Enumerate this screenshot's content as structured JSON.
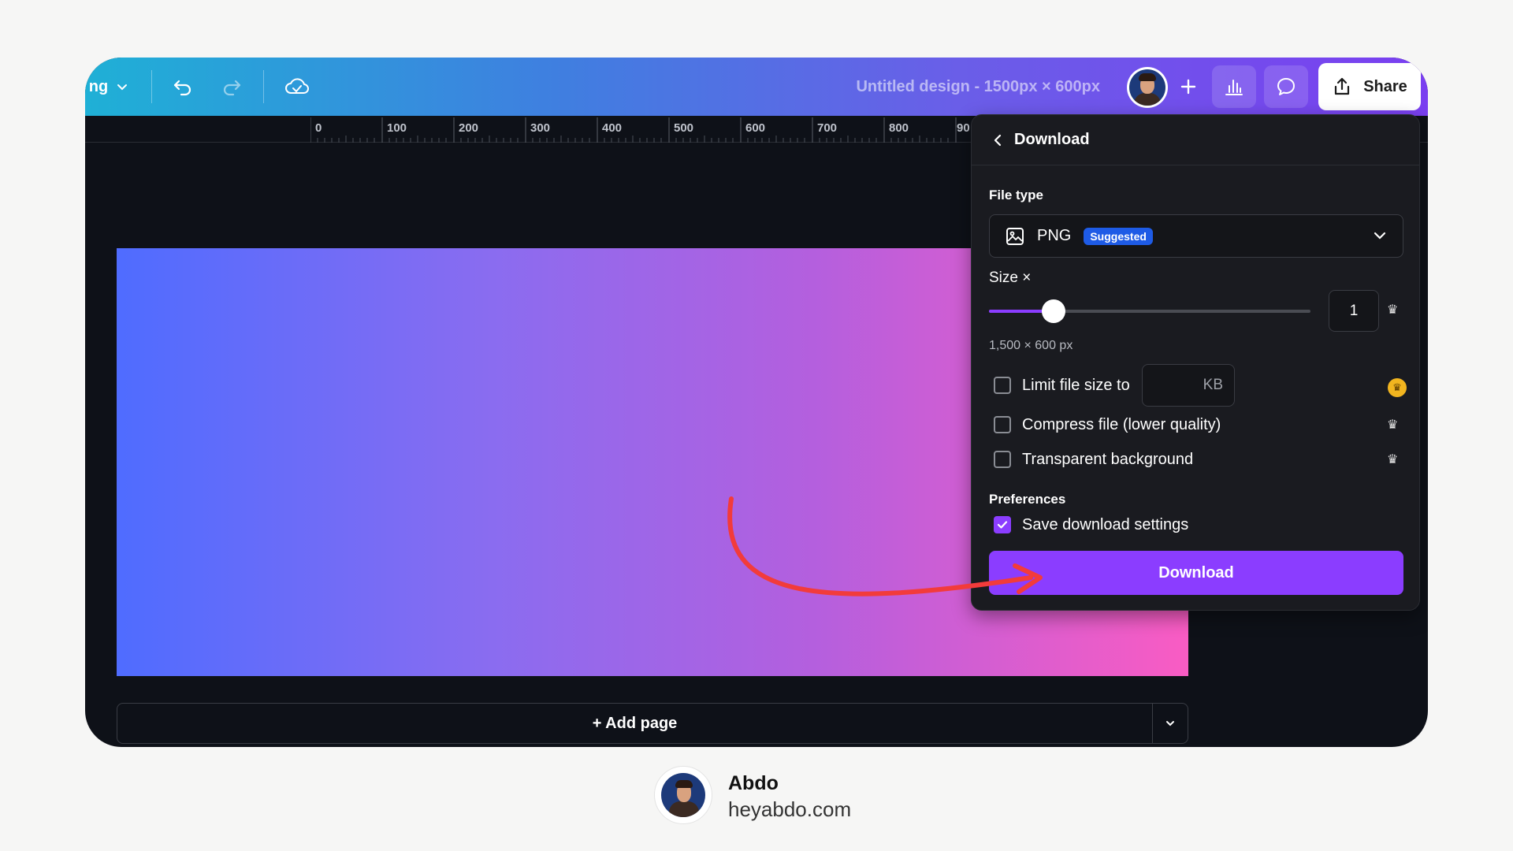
{
  "topbar": {
    "zoom_label": "ng",
    "doc_title": "Untitled design - 1500px × 600px",
    "share_label": "Share",
    "icons": [
      "chevron-down-icon",
      "undo-icon",
      "redo-icon",
      "cloud-check-icon",
      "plus-icon",
      "bar-chart-icon",
      "comment-icon",
      "share-upload-icon"
    ]
  },
  "ruler": {
    "ticks": [
      "0",
      "100",
      "200",
      "300",
      "400",
      "500",
      "600",
      "700",
      "800",
      "90"
    ]
  },
  "canvas": {
    "gradient_colors": [
      "#4f6cff",
      "#b45fde",
      "#f95cc3"
    ]
  },
  "add_page": {
    "label": "+ Add page"
  },
  "download_panel": {
    "title": "Download",
    "file_type_label": "File type",
    "file_type_value": "PNG",
    "file_type_badge": "Suggested",
    "size_label": "Size ×",
    "size_value": "1",
    "size_slider_fraction": 0.2,
    "dimensions": "1,500 × 600 px",
    "limit_file_size_label": "Limit file size to",
    "limit_file_size_unit": "KB",
    "compress_label": "Compress file (lower quality)",
    "transparent_label": "Transparent background",
    "preferences_label": "Preferences",
    "save_settings_label": "Save download settings",
    "save_settings_checked": true,
    "download_button": "Download"
  },
  "footer": {
    "name": "Abdo",
    "site": "heyabdo.com"
  },
  "colors": {
    "accent": "#8b3dff",
    "annotation_arrow": "#f23b3b"
  }
}
